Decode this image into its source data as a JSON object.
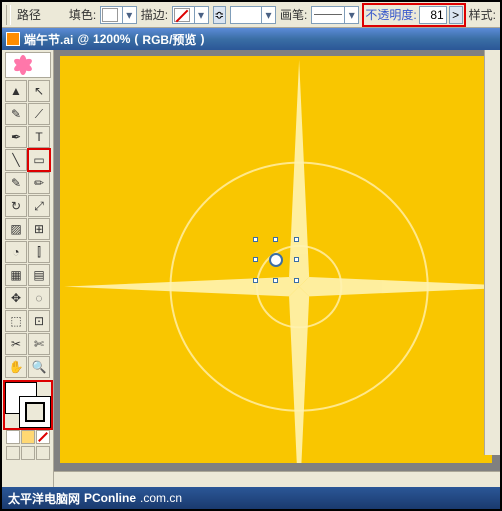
{
  "options": {
    "path_label": "路径",
    "fill_label": "填色:",
    "stroke_label": "描边:",
    "stroke_weight": "",
    "brush_label": "画笔:",
    "opacity_label": "不透明度:",
    "opacity_value": "81",
    "style_label": "样式:"
  },
  "title": {
    "filename": "端午节.ai",
    "zoom": "1200%",
    "colormode": "RGB/预览"
  },
  "tools": [
    {
      "icon": "▲",
      "name": "selection"
    },
    {
      "icon": "↖",
      "name": "direct-select"
    },
    {
      "icon": "✎",
      "name": "magic-wand"
    },
    {
      "icon": "⟋",
      "name": "lasso"
    },
    {
      "icon": "✒",
      "name": "pen"
    },
    {
      "icon": "T",
      "name": "type"
    },
    {
      "icon": "╲",
      "name": "line"
    },
    {
      "icon": "▭",
      "name": "rectangle"
    },
    {
      "icon": "✎",
      "name": "paintbrush"
    },
    {
      "icon": "✏",
      "name": "pencil"
    },
    {
      "icon": "↻",
      "name": "rotate"
    },
    {
      "icon": "⤢",
      "name": "scale"
    },
    {
      "icon": "▨",
      "name": "warp"
    },
    {
      "icon": "⊞",
      "name": "free-transform"
    },
    {
      "icon": "◔",
      "name": "symbol-sprayer"
    },
    {
      "icon": "⫿",
      "name": "column-graph"
    },
    {
      "icon": "▦",
      "name": "mesh"
    },
    {
      "icon": "▤",
      "name": "gradient"
    },
    {
      "icon": "✥",
      "name": "eyedropper"
    },
    {
      "icon": "◌",
      "name": "blend"
    },
    {
      "icon": "⬚",
      "name": "live-paint"
    },
    {
      "icon": "⊡",
      "name": "live-paint-select"
    },
    {
      "icon": "✂",
      "name": "slice"
    },
    {
      "icon": "✄",
      "name": "scissors"
    },
    {
      "icon": "✋",
      "name": "hand"
    },
    {
      "icon": "🔍",
      "name": "zoom"
    }
  ],
  "highlighted_tools": [
    "rectangle"
  ],
  "minirow": [
    "white",
    "yellow",
    "none"
  ],
  "footer": {
    "brand1": "太平洋电脑网",
    "brand2": "PConline",
    "suffix": ".com.cn"
  }
}
